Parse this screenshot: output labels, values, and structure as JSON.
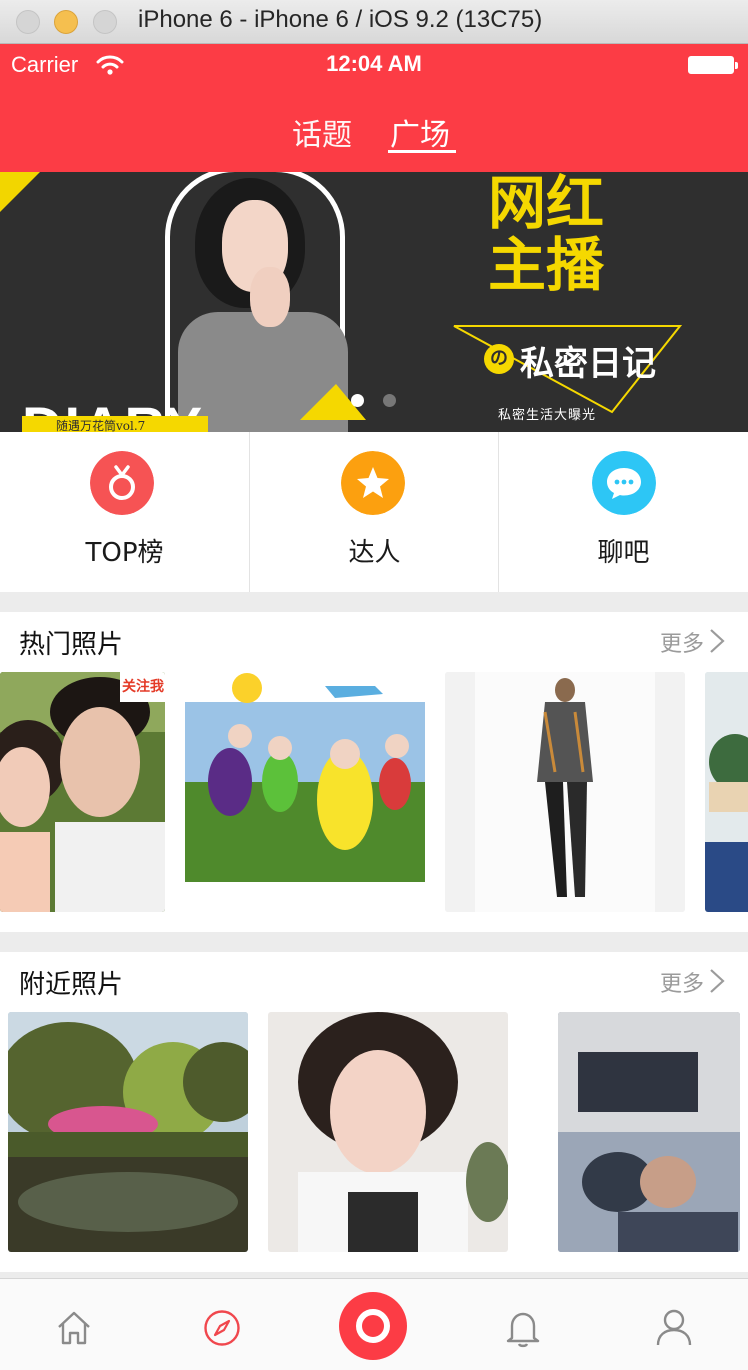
{
  "window": {
    "title": "iPhone 6 - iPhone 6 / iOS 9.2 (13C75)"
  },
  "status": {
    "carrier": "Carrier",
    "time": "12:04 AM"
  },
  "nav": {
    "tabs": [
      {
        "label": "话题",
        "active": false
      },
      {
        "label": "广场",
        "active": true
      }
    ]
  },
  "banner": {
    "headline": "网红\n主播",
    "badge": "の",
    "subhead": "私密日记",
    "small_text": "私密生活大曝光",
    "diary": "DIARY",
    "caption": "随遇万花筒vol.7",
    "page_count": 2,
    "active_page": 1
  },
  "quick": [
    {
      "label": "TOP榜",
      "icon": "medal-icon",
      "color": "#f65354"
    },
    {
      "label": "达人",
      "icon": "star-icon",
      "color": "#fca00f"
    },
    {
      "label": "聊吧",
      "icon": "chat-bubble-icon",
      "color": "#2dc6f5"
    }
  ],
  "sections": {
    "hot": {
      "title": "热门照片",
      "more": "更多"
    },
    "near": {
      "title": "附近照片",
      "more": "更多"
    }
  },
  "hot_photo_texts": {
    "sticker": "关注我"
  },
  "tabbar": [
    {
      "name": "home",
      "icon": "home-icon",
      "color": "#8a8a8a"
    },
    {
      "name": "discover",
      "icon": "compass-icon",
      "color": "#f0474d"
    },
    {
      "name": "camera",
      "icon": "record-icon",
      "color": "#fc3c45"
    },
    {
      "name": "notifications",
      "icon": "bell-icon",
      "color": "#8a8a8a"
    },
    {
      "name": "profile",
      "icon": "user-icon",
      "color": "#8a8a8a"
    }
  ]
}
